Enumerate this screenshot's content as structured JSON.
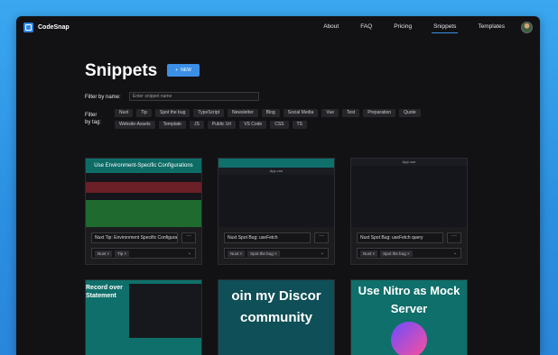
{
  "app": {
    "name": "CodeSnap"
  },
  "nav": {
    "items": [
      "About",
      "FAQ",
      "Pricing",
      "Snippets",
      "Templates"
    ],
    "active": "Snippets"
  },
  "page": {
    "title": "Snippets",
    "new_button": "NEW",
    "new_icon": "+"
  },
  "filters": {
    "name_label": "Filter by name:",
    "name_placeholder": "Enter snippet name",
    "tag_label": "Filter by tag:",
    "tags_row1": [
      "Nuxt",
      "Tip",
      "Spot the bug",
      "TypeScript",
      "Newsletter",
      "Blog",
      "Social Media",
      "Vue",
      "Test",
      "Preparation",
      "Quote"
    ],
    "tags_row2": [
      "Website-Assets",
      "Template",
      "JS",
      "Public Url",
      "VS Code",
      "CSS",
      "TS"
    ]
  },
  "cards": [
    {
      "thumb_title": "Use Environment-Specific Configurations",
      "title": "Nuxt Tip: Environment Specific Configurations",
      "tags": [
        "Nuxt",
        "Tip"
      ],
      "more": "···",
      "remove": "×",
      "chevron": "⌄"
    },
    {
      "thumb_title": "App.vue",
      "title": "Nuxt Spot Bug: useFetch",
      "tags": [
        "Nuxt",
        "Spot the bug"
      ],
      "more": "···",
      "remove": "×",
      "chevron": "⌄"
    },
    {
      "thumb_title": "App.vue",
      "title": "Nuxt Spot Bug: useFetch query",
      "tags": [
        "Nuxt",
        "Spot the bug"
      ],
      "more": "···",
      "remove": "×",
      "chevron": "⌄"
    },
    {
      "thumb_title": "Record over Statement"
    },
    {
      "thumb_title": "oin my Discor community"
    },
    {
      "thumb_title": "Use Nitro as Mock Server"
    }
  ],
  "colors": {
    "accent": "#3b8fe6",
    "bg": "#121214",
    "card": "#1c1c1f"
  }
}
